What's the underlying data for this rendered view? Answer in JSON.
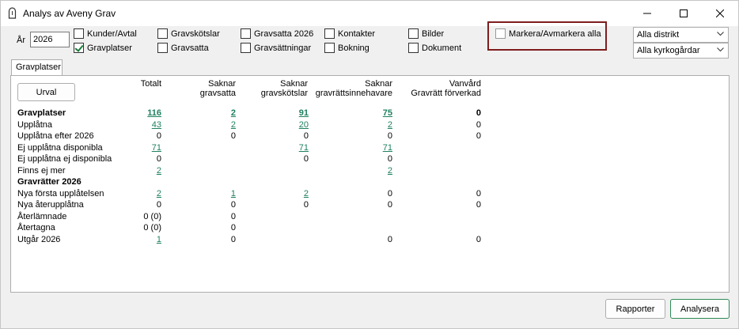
{
  "window": {
    "title": "Analys av Aveny Grav"
  },
  "filters": {
    "year_label": "År",
    "year_value": "2026",
    "checkboxes": [
      {
        "label": "Kunder/Avtal",
        "checked": false
      },
      {
        "label": "Gravplatser",
        "checked": true
      },
      {
        "label": "Gravskötslar",
        "checked": false
      },
      {
        "label": "Gravsatta",
        "checked": false
      },
      {
        "label": "Gravsatta 2026",
        "checked": false
      },
      {
        "label": "Gravsättningar",
        "checked": false
      },
      {
        "label": "Kontakter",
        "checked": false
      },
      {
        "label": "Bokning",
        "checked": false
      },
      {
        "label": "Bilder",
        "checked": false
      },
      {
        "label": "Dokument",
        "checked": false
      },
      {
        "label": "Markera/Avmarkera alla",
        "checked": false
      }
    ],
    "district": "Alla distrikt",
    "churchyard": "Alla kyrkogårdar"
  },
  "tab": {
    "label": "Gravplatser"
  },
  "panel": {
    "urval_label": "Urval",
    "columns": [
      {
        "line1": "Totalt",
        "line2": ""
      },
      {
        "line1": "Saknar",
        "line2": "gravsatta"
      },
      {
        "line1": "Saknar",
        "line2": "gravskötslar"
      },
      {
        "line1": "Saknar",
        "line2": "gravrättsinnehavare"
      },
      {
        "line1": "Vanvård",
        "line2": "Gravrätt förverkad"
      }
    ],
    "rows": [
      {
        "label": "Gravplatser",
        "bold": true,
        "cells": [
          {
            "v": "116",
            "link": true
          },
          {
            "v": "2",
            "link": true
          },
          {
            "v": "91",
            "link": true
          },
          {
            "v": "75",
            "link": true
          },
          {
            "v": "0",
            "link": false
          }
        ]
      },
      {
        "label": "Upplåtna",
        "bold": false,
        "cells": [
          {
            "v": "43",
            "link": true
          },
          {
            "v": "2",
            "link": true
          },
          {
            "v": "20",
            "link": true
          },
          {
            "v": "2",
            "link": true
          },
          {
            "v": "0",
            "link": false
          }
        ]
      },
      {
        "label": "Upplåtna efter 2026",
        "bold": false,
        "cells": [
          {
            "v": "0",
            "link": false
          },
          {
            "v": "0",
            "link": false
          },
          {
            "v": "0",
            "link": false
          },
          {
            "v": "0",
            "link": false
          },
          {
            "v": "0",
            "link": false
          }
        ]
      },
      {
        "label": "Ej upplåtna disponibla",
        "bold": false,
        "cells": [
          {
            "v": "71",
            "link": true
          },
          {
            "v": "",
            "link": false
          },
          {
            "v": "71",
            "link": true
          },
          {
            "v": "71",
            "link": true
          },
          {
            "v": "",
            "link": false
          }
        ]
      },
      {
        "label": "Ej upplåtna ej disponibla",
        "bold": false,
        "cells": [
          {
            "v": "0",
            "link": false
          },
          {
            "v": "",
            "link": false
          },
          {
            "v": "0",
            "link": false
          },
          {
            "v": "0",
            "link": false
          },
          {
            "v": "",
            "link": false
          }
        ]
      },
      {
        "label": "Finns ej mer",
        "bold": false,
        "cells": [
          {
            "v": "2",
            "link": true
          },
          {
            "v": "",
            "link": false
          },
          {
            "v": "",
            "link": false
          },
          {
            "v": "2",
            "link": true
          },
          {
            "v": "",
            "link": false
          }
        ]
      },
      {
        "label": "Gravrätter 2026",
        "bold": true,
        "cells": [
          {
            "v": "",
            "link": false
          },
          {
            "v": "",
            "link": false
          },
          {
            "v": "",
            "link": false
          },
          {
            "v": "",
            "link": false
          },
          {
            "v": "",
            "link": false
          }
        ]
      },
      {
        "label": "Nya första upplåtelsen",
        "bold": false,
        "cells": [
          {
            "v": "2",
            "link": true
          },
          {
            "v": "1",
            "link": true
          },
          {
            "v": "2",
            "link": true
          },
          {
            "v": "0",
            "link": false
          },
          {
            "v": "0",
            "link": false
          }
        ]
      },
      {
        "label": "Nya återupplåtna",
        "bold": false,
        "cells": [
          {
            "v": "0",
            "link": false
          },
          {
            "v": "0",
            "link": false
          },
          {
            "v": "0",
            "link": false
          },
          {
            "v": "0",
            "link": false
          },
          {
            "v": "0",
            "link": false
          }
        ]
      },
      {
        "label": "Återlämnade",
        "bold": false,
        "cells": [
          {
            "v": "0 (0)",
            "link": false
          },
          {
            "v": "0",
            "link": false
          },
          {
            "v": "",
            "link": false
          },
          {
            "v": "",
            "link": false
          },
          {
            "v": "",
            "link": false
          }
        ]
      },
      {
        "label": "Återtagna",
        "bold": false,
        "cells": [
          {
            "v": "0 (0)",
            "link": false
          },
          {
            "v": "0",
            "link": false
          },
          {
            "v": "",
            "link": false
          },
          {
            "v": "",
            "link": false
          },
          {
            "v": "",
            "link": false
          }
        ]
      },
      {
        "label": "Utgår 2026",
        "bold": false,
        "cells": [
          {
            "v": "1",
            "link": true
          },
          {
            "v": "0",
            "link": false
          },
          {
            "v": "",
            "link": false
          },
          {
            "v": "0",
            "link": false
          },
          {
            "v": "0",
            "link": false
          }
        ]
      }
    ]
  },
  "footer": {
    "reports_label": "Rapporter",
    "analyze_label": "Analysera"
  },
  "icons": {
    "minimize": "minimize-icon",
    "maximize": "maximize-icon",
    "close": "close-icon",
    "app": "grave-app-icon"
  },
  "colors": {
    "link": "#1f8060",
    "highlight_border": "#7f1d1d",
    "checkmark": "#1a7d3a"
  }
}
